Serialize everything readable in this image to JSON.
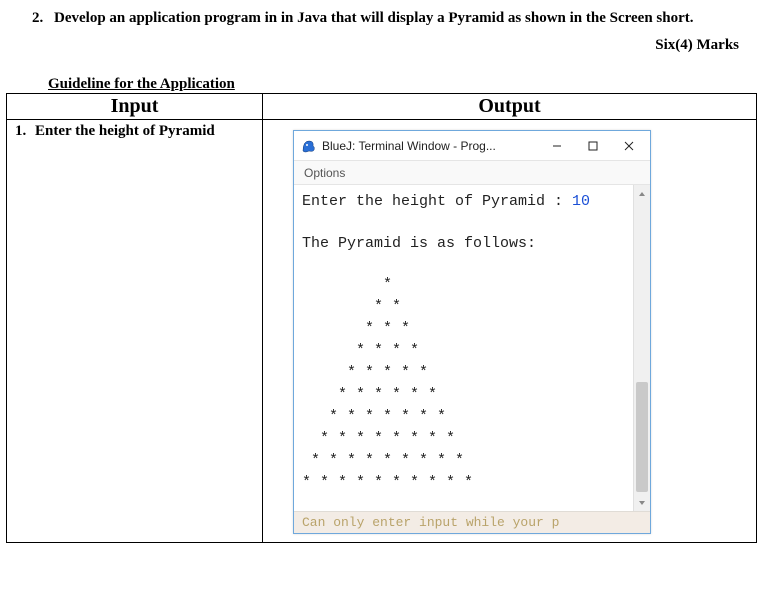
{
  "question": {
    "number": "2.",
    "text": "Develop an application program in in Java that will display a Pyramid as shown in the Screen short.",
    "marks": "Six(4) Marks",
    "guideline_heading": "Guideline for the Application"
  },
  "table": {
    "headers": {
      "input": "Input",
      "output": "Output"
    },
    "input_item": {
      "num": "1.",
      "text": "Enter the height of Pyramid"
    }
  },
  "terminal": {
    "window_title": "BlueJ: Terminal Window - Prog...",
    "menu_options": "Options",
    "prompt_prefix": "Enter the height of Pyramid : ",
    "prompt_value": "10",
    "result_heading": "The Pyramid is as follows:",
    "pyramid": "         *\n        * *\n       * * *\n      * * * *\n     * * * * *\n    * * * * * *\n   * * * * * * *\n  * * * * * * * *\n * * * * * * * * *\n* * * * * * * * * *",
    "footer_hint": "Can only enter input while your p"
  }
}
